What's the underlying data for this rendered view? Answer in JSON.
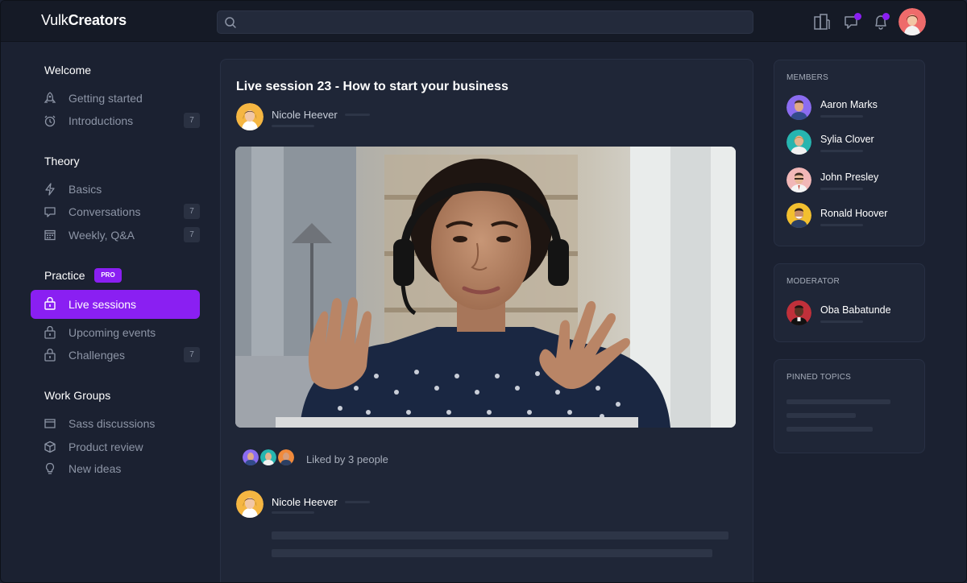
{
  "app": {
    "logo_light": "Vulk",
    "logo_bold": "Creators"
  },
  "header": {
    "search_placeholder": "",
    "icons": [
      "search-icon",
      "apartment-icon",
      "chat-icon",
      "bell-icon"
    ],
    "notification_color": "#8a1ff2"
  },
  "sidebar": {
    "sections": [
      {
        "title": "Welcome",
        "items": [
          {
            "label": "Getting started",
            "icon": "rocket-icon"
          },
          {
            "label": "Introductions",
            "icon": "alarm-icon",
            "badge": "7"
          }
        ]
      },
      {
        "title": "Theory",
        "items": [
          {
            "label": "Basics",
            "icon": "bolt-icon"
          },
          {
            "label": "Conversations",
            "icon": "chat-icon",
            "badge": "7"
          },
          {
            "label": "Weekly, Q&A",
            "icon": "calendar-icon",
            "badge": "7"
          }
        ]
      },
      {
        "title": "Practice",
        "badge": "PRO",
        "items": [
          {
            "label": "Live sessions",
            "icon": "lock-icon",
            "active": true
          },
          {
            "label": "Upcoming events",
            "icon": "lock-icon"
          },
          {
            "label": "Challenges",
            "icon": "lock-icon",
            "badge": "7"
          }
        ]
      },
      {
        "title": "Work Groups",
        "items": [
          {
            "label": "Sass discussions",
            "icon": "window-icon"
          },
          {
            "label": "Product review",
            "icon": "cube-icon"
          },
          {
            "label": "New ideas",
            "icon": "bulb-icon"
          }
        ]
      }
    ],
    "accent_color": "#8a1ff2"
  },
  "post": {
    "title": "Live session 23 - How to start your business",
    "author": "Nicole Heever",
    "liked_text": "Liked by 3 people"
  },
  "comment": {
    "author": "Nicole Heever"
  },
  "members": {
    "title": "MEMBERS",
    "items": [
      "Aaron Marks",
      "Sylia Clover",
      "John Presley",
      "Ronald Hoover"
    ]
  },
  "moderator": {
    "title": "MODERATOR",
    "name": "Oba Babatunde"
  },
  "pinned": {
    "title": "PINNED TOPICS"
  }
}
